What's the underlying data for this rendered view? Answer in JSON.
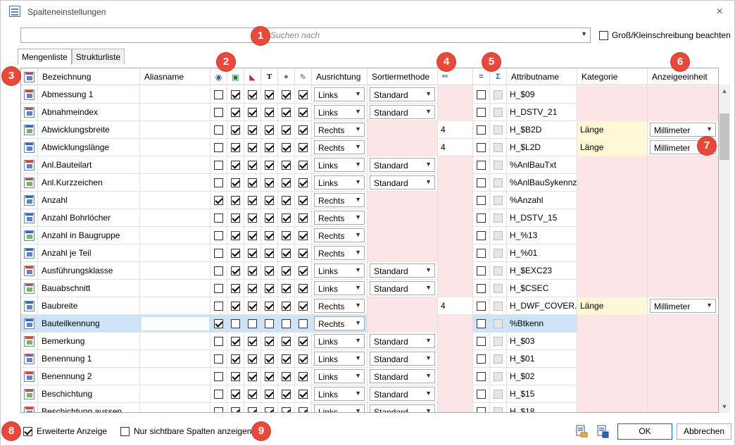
{
  "window": {
    "title": "Spalteneinstellungen",
    "close_glyph": "×"
  },
  "search": {
    "placeholder": "Suchen nach",
    "case_label": "Groß/Kleinschreibung beachten"
  },
  "tabs": [
    {
      "label": "Mengenliste",
      "active": true
    },
    {
      "label": "Strukturliste",
      "active": false
    }
  ],
  "columns": {
    "bezeichnung": "Bezeichnung",
    "aliasname": "Aliasname",
    "ausrichtung": "Ausrichtung",
    "sortiermethode": "Sortiermethode",
    "attributname": "Attributname",
    "kategorie": "Kategorie",
    "anzeigeeinheit": "Anzeigeeinheit",
    "icon_eye": "eye-icon",
    "icon_excel": "excel-icon",
    "icon_pdf": "pdf-icon",
    "icon_text": "T",
    "icon_globe": "globe-icon",
    "icon_pen": "pen-icon",
    "icon_precision": "precision-icon",
    "icon_equal": "=",
    "icon_sum": "Σ"
  },
  "rows": [
    {
      "name": "Abmessung 1",
      "alias": "",
      "eye": false,
      "c2": true,
      "c3": true,
      "c4": true,
      "c5": true,
      "c6": true,
      "align": "Links",
      "sort": "Standard",
      "prec": "",
      "eq": false,
      "sum": false,
      "attr": "H_$09",
      "cat": "",
      "unit": ""
    },
    {
      "name": "Abnahmeindex",
      "alias": "",
      "eye": false,
      "c2": true,
      "c3": true,
      "c4": true,
      "c5": true,
      "c6": true,
      "align": "Links",
      "sort": "Standard",
      "prec": "",
      "eq": false,
      "sum": false,
      "attr": "H_DSTV_21",
      "cat": "",
      "unit": ""
    },
    {
      "name": "Abwicklungsbreite",
      "alias": "",
      "eye": false,
      "c2": true,
      "c3": true,
      "c4": true,
      "c5": true,
      "c6": true,
      "align": "Rechts",
      "sort": "",
      "prec": "4",
      "eq": false,
      "sum": false,
      "attr": "H_$B2D",
      "cat": "Länge",
      "unit": "Millimeter"
    },
    {
      "name": "Abwicklungslänge",
      "alias": "",
      "eye": false,
      "c2": true,
      "c3": true,
      "c4": true,
      "c5": true,
      "c6": true,
      "align": "Rechts",
      "sort": "",
      "prec": "4",
      "eq": false,
      "sum": false,
      "attr": "H_$L2D",
      "cat": "Länge",
      "unit": "Millimeter"
    },
    {
      "name": "Anl.Bauteilart",
      "alias": "",
      "eye": false,
      "c2": true,
      "c3": true,
      "c4": true,
      "c5": true,
      "c6": true,
      "align": "Links",
      "sort": "Standard",
      "prec": "",
      "eq": false,
      "sum": false,
      "attr": "%AnlBauTxt",
      "cat": "",
      "unit": ""
    },
    {
      "name": "Anl.Kurzzeichen",
      "alias": "",
      "eye": false,
      "c2": true,
      "c3": true,
      "c4": true,
      "c5": true,
      "c6": true,
      "align": "Links",
      "sort": "Standard",
      "prec": "",
      "eq": false,
      "sum": false,
      "attr": "%AnlBauSykennz",
      "cat": "",
      "unit": ""
    },
    {
      "name": "Anzahl",
      "alias": "",
      "eye": true,
      "c2": true,
      "c3": true,
      "c4": true,
      "c5": true,
      "c6": true,
      "align": "Rechts",
      "sort": "",
      "prec": "",
      "eq": false,
      "sum": false,
      "attr": "%Anzahl",
      "cat": "",
      "unit": ""
    },
    {
      "name": "Anzahl Bohrlöcher",
      "alias": "",
      "eye": false,
      "c2": true,
      "c3": true,
      "c4": true,
      "c5": true,
      "c6": true,
      "align": "Rechts",
      "sort": "",
      "prec": "",
      "eq": false,
      "sum": false,
      "attr": "H_DSTV_15",
      "cat": "",
      "unit": ""
    },
    {
      "name": "Anzahl in Baugruppe",
      "alias": "",
      "eye": false,
      "c2": true,
      "c3": true,
      "c4": true,
      "c5": true,
      "c6": true,
      "align": "Rechts",
      "sort": "",
      "prec": "",
      "eq": false,
      "sum": false,
      "attr": "H_%13",
      "cat": "",
      "unit": ""
    },
    {
      "name": "Anzahl je Teil",
      "alias": "",
      "eye": false,
      "c2": true,
      "c3": true,
      "c4": true,
      "c5": true,
      "c6": true,
      "align": "Rechts",
      "sort": "",
      "prec": "",
      "eq": false,
      "sum": false,
      "attr": "H_%01",
      "cat": "",
      "unit": ""
    },
    {
      "name": "Ausführungsklasse",
      "alias": "",
      "eye": false,
      "c2": true,
      "c3": true,
      "c4": true,
      "c5": true,
      "c6": true,
      "align": "Links",
      "sort": "Standard",
      "prec": "",
      "eq": false,
      "sum": false,
      "attr": "H_$EXC23",
      "cat": "",
      "unit": ""
    },
    {
      "name": "Bauabschnitt",
      "alias": "",
      "eye": false,
      "c2": true,
      "c3": true,
      "c4": true,
      "c5": true,
      "c6": true,
      "align": "Links",
      "sort": "Standard",
      "prec": "",
      "eq": false,
      "sum": false,
      "attr": "H_$CSEC",
      "cat": "",
      "unit": ""
    },
    {
      "name": "Baubreite",
      "alias": "",
      "eye": false,
      "c2": true,
      "c3": true,
      "c4": true,
      "c5": true,
      "c6": true,
      "align": "Rechts",
      "sort": "",
      "prec": "4",
      "eq": false,
      "sum": false,
      "attr": "H_DWF_COVER...",
      "cat": "Länge",
      "unit": "Millimeter"
    },
    {
      "name": "Bauteilkennung",
      "alias": "",
      "eye": true,
      "c2": false,
      "c3": false,
      "c4": false,
      "c5": false,
      "c6": false,
      "align": "Rechts",
      "sort": "",
      "prec": "",
      "eq": false,
      "sum": false,
      "attr": "%Btkenn",
      "cat": "",
      "unit": "",
      "selected": true
    },
    {
      "name": "Bemerkung",
      "alias": "",
      "eye": false,
      "c2": true,
      "c3": true,
      "c4": true,
      "c5": true,
      "c6": true,
      "align": "Links",
      "sort": "Standard",
      "prec": "",
      "eq": false,
      "sum": false,
      "attr": "H_$03",
      "cat": "",
      "unit": ""
    },
    {
      "name": "Benennung 1",
      "alias": "",
      "eye": false,
      "c2": true,
      "c3": true,
      "c4": true,
      "c5": true,
      "c6": true,
      "align": "Links",
      "sort": "Standard",
      "prec": "",
      "eq": false,
      "sum": false,
      "attr": "H_$01",
      "cat": "",
      "unit": ""
    },
    {
      "name": "Benennung 2",
      "alias": "",
      "eye": false,
      "c2": true,
      "c3": true,
      "c4": true,
      "c5": true,
      "c6": true,
      "align": "Links",
      "sort": "Standard",
      "prec": "",
      "eq": false,
      "sum": false,
      "attr": "H_$02",
      "cat": "",
      "unit": ""
    },
    {
      "name": "Beschichtung",
      "alias": "",
      "eye": false,
      "c2": true,
      "c3": true,
      "c4": true,
      "c5": true,
      "c6": true,
      "align": "Links",
      "sort": "Standard",
      "prec": "",
      "eq": false,
      "sum": false,
      "attr": "H_$15",
      "cat": "",
      "unit": ""
    },
    {
      "name": "Beschichtung aussen",
      "alias": "",
      "eye": false,
      "c2": true,
      "c3": true,
      "c4": true,
      "c5": true,
      "c6": true,
      "align": "Links",
      "sort": "Standard",
      "prec": "",
      "eq": false,
      "sum": false,
      "attr": "H_$18",
      "cat": "",
      "unit": ""
    }
  ],
  "footer": {
    "extended_label": "Erweiterte Anzeige",
    "extended_checked": true,
    "visible_only_label": "Nur sichtbare Spalten anzeigen",
    "visible_only_checked": false,
    "ok_label": "OK",
    "cancel_label": "Abbrechen"
  },
  "badges": [
    "1",
    "2",
    "3",
    "4",
    "5",
    "6",
    "7",
    "8",
    "9"
  ],
  "colors": {
    "badge": "#e8493b",
    "pink": "#fde4e6",
    "yellow": "#fcf8d6",
    "selected": "#cde3f7"
  }
}
